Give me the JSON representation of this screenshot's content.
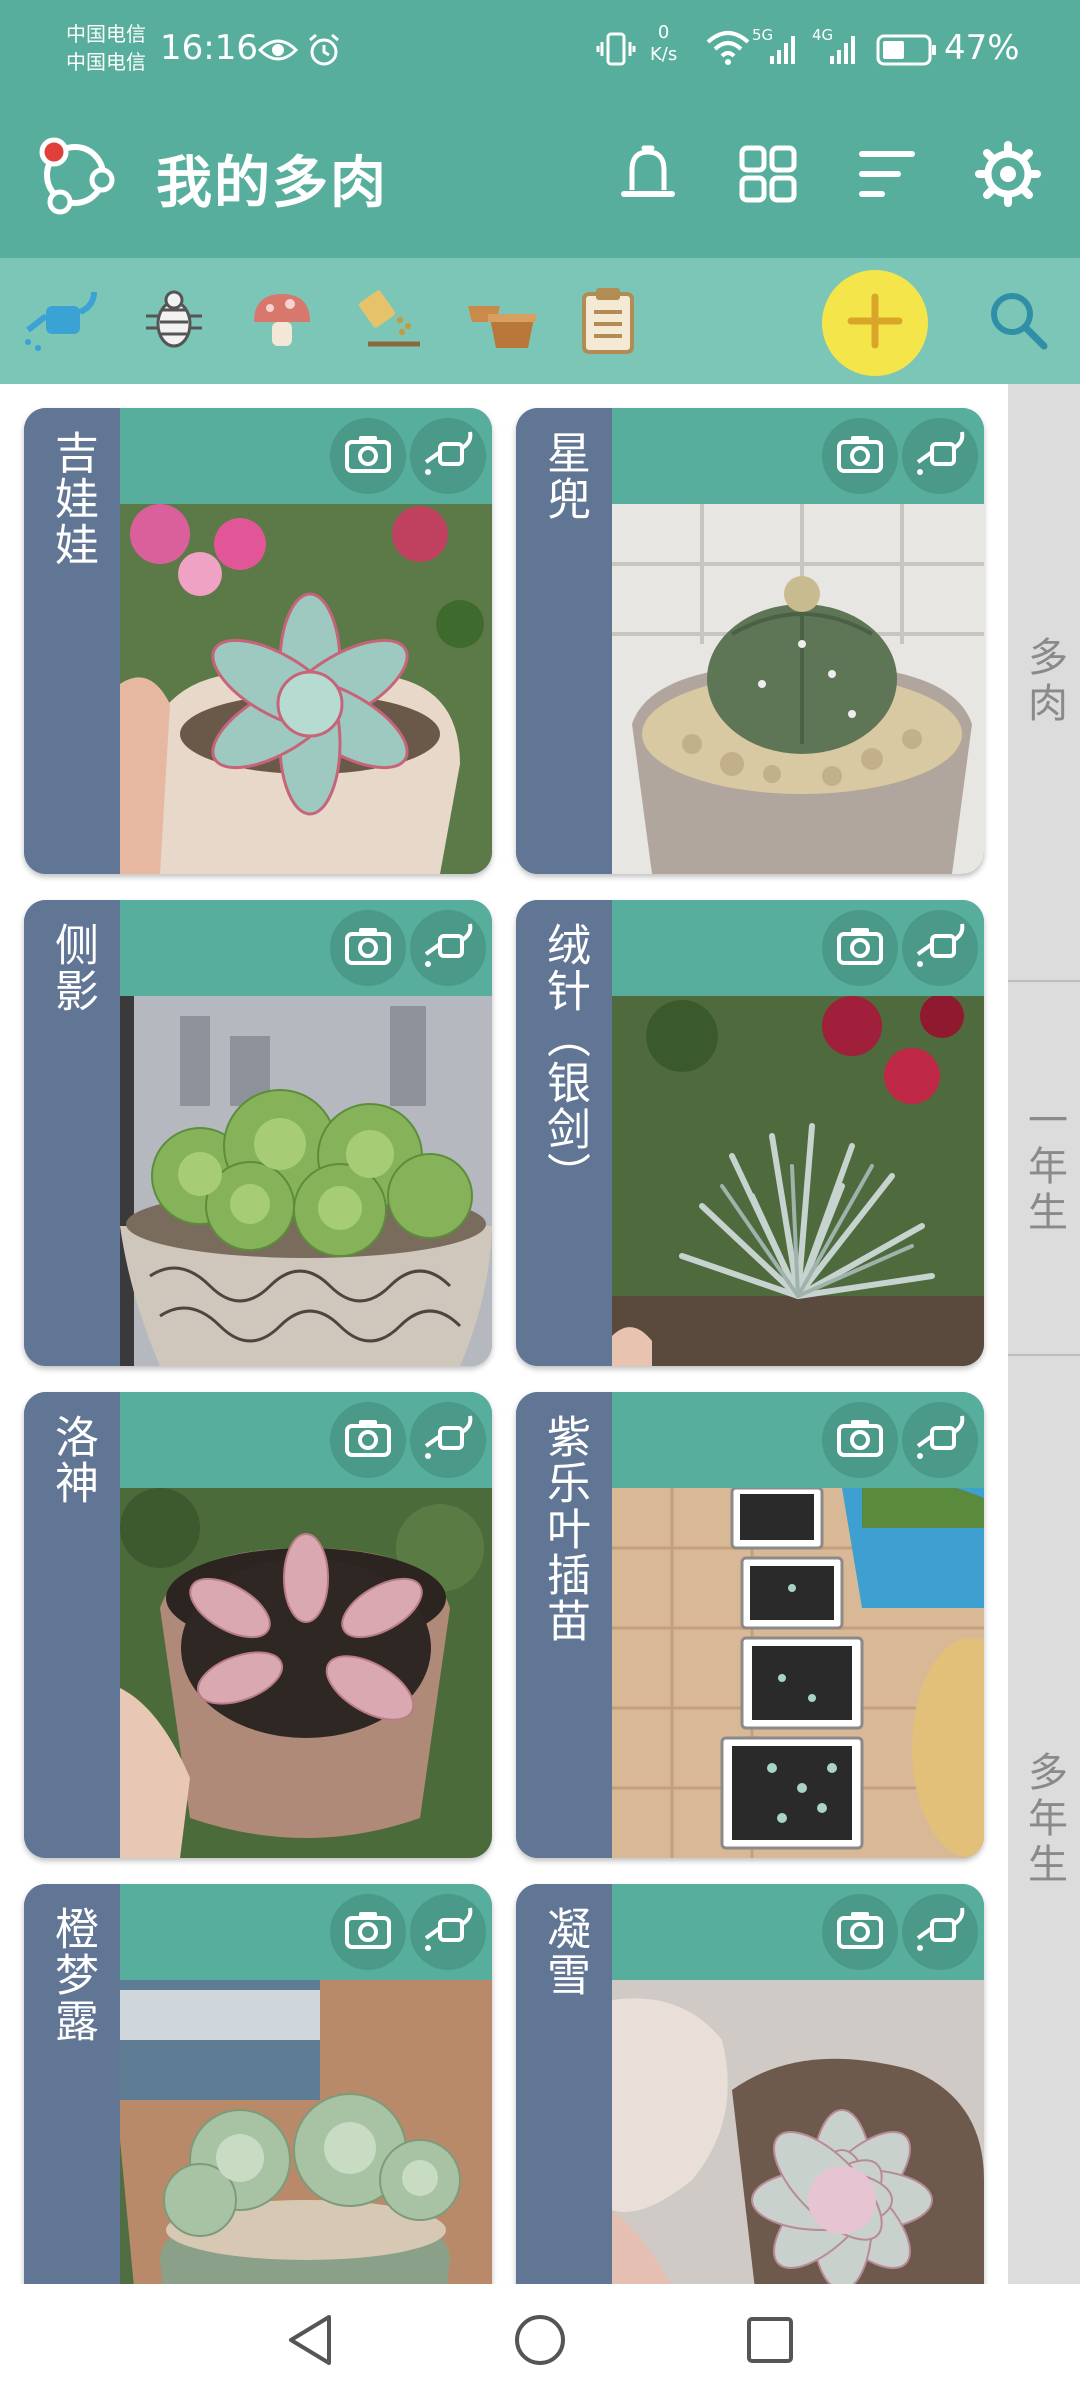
{
  "status_bar": {
    "carrier1": "中国电信",
    "carrier2": "中国电信",
    "time": "16:16",
    "net_speed_value": "0",
    "net_speed_unit": "K/s",
    "battery": "47%",
    "net1": "5G",
    "net2": "4G"
  },
  "app_bar": {
    "title": "我的多肉"
  },
  "toolbar": {
    "icons": [
      "watering-can-icon",
      "bug-icon",
      "mushroom-icon",
      "fertilizer-icon",
      "repot-icon",
      "clipboard-icon"
    ]
  },
  "plants": [
    {
      "name": "吉娃娃"
    },
    {
      "name": "星兜"
    },
    {
      "name": "侧影"
    },
    {
      "name": "绒针（银剑）"
    },
    {
      "name": "洛神"
    },
    {
      "name": "紫乐叶插苗"
    },
    {
      "name": "橙梦露"
    },
    {
      "name": "凝雪"
    }
  ],
  "side_index": [
    "多肉",
    "一年生",
    "多年生"
  ],
  "colors": {
    "primary": "#57ae9c",
    "toolbar": "#7cc6b8",
    "label": "#617594",
    "accent": "#f4e64a"
  }
}
